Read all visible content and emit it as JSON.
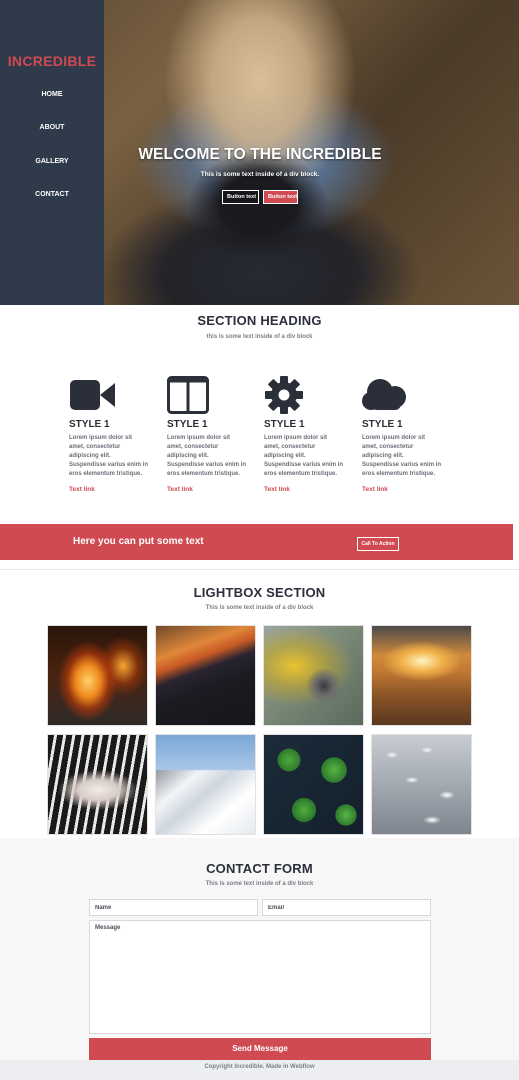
{
  "brand": {
    "name": "INCREDIBLE",
    "color": "#d04a52"
  },
  "nav": {
    "items": [
      {
        "label": "HOME"
      },
      {
        "label": "ABOUT"
      },
      {
        "label": "GALLERY"
      },
      {
        "label": "CONTACT"
      }
    ]
  },
  "hero": {
    "title": "WELCOME TO THE INCREDIBLE",
    "subtitle": "This is some text inside of a div block.",
    "button1": "Button text",
    "button2": "Button text"
  },
  "section": {
    "heading": "SECTION HEADING",
    "subheading": "this is some text inside of a div block"
  },
  "features": [
    {
      "icon": "video-camera-icon",
      "title": "STYLE 1",
      "text": "Lorem ipsum dolor sit amet, consectetur adipiscing elit. Suspendisse varius enim in eros elementum tristique.",
      "link": "Text link"
    },
    {
      "icon": "columns-layout-icon",
      "title": "STYLE 1",
      "text": "Lorem ipsum dolor sit amet, consectetur adipiscing elit. Suspendisse varius enim in eros elementum tristique.",
      "link": "Text link"
    },
    {
      "icon": "gear-icon",
      "title": "STYLE 1",
      "text": "Lorem ipsum dolor sit amet, consectetur adipiscing elit. Suspendisse varius enim in eros elementum tristique.",
      "link": "Text link"
    },
    {
      "icon": "cloud-icon",
      "title": "STYLE 1",
      "text": "Lorem ipsum dolor sit amet, consectetur adipiscing elit. Suspendisse varius enim in eros elementum tristique.",
      "link": "Text link"
    }
  ],
  "cta": {
    "text": "Here you can put some text",
    "button": "Call To Action"
  },
  "lightbox": {
    "heading": "LIGHTBOX SECTION",
    "subheading": "This is some text inside of a div block"
  },
  "contact": {
    "heading": "CONTACT FORM",
    "subheading": "This is some text inside of a div block",
    "name_placeholder": "Name",
    "email_placeholder": "Email",
    "message_placeholder": "Message",
    "submit": "Send Message"
  },
  "footer": {
    "text": "Copyright Incredible. Made in Webflow"
  },
  "colors": {
    "accent": "#d04a52",
    "sidebar": "#2f3a4a",
    "text": "#2a2f3a"
  }
}
